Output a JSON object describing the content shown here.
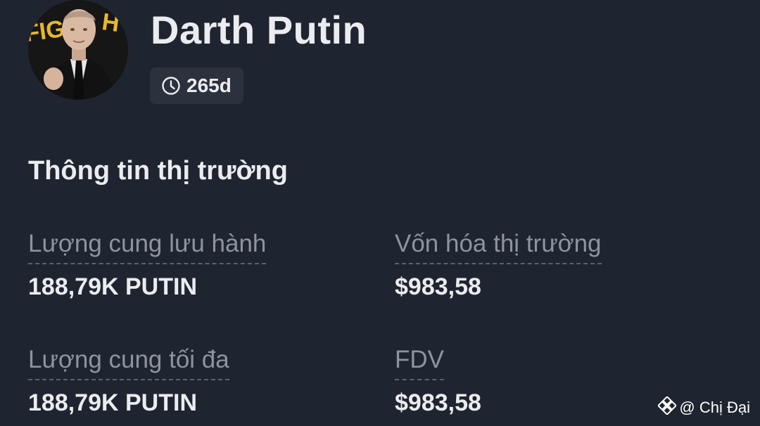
{
  "header": {
    "token_name": "Darth Putin",
    "age_badge": "265d",
    "avatar_icon": "person-photo-avatar"
  },
  "market_info": {
    "title": "Thông tin thị trường",
    "stats": [
      {
        "label": "Lượng cung lưu hành",
        "value": "188,79K PUTIN"
      },
      {
        "label": "Vốn hóa thị trường",
        "value": "$983,58"
      },
      {
        "label": "Lượng cung tối đa",
        "value": "188,79K PUTIN"
      },
      {
        "label": "FDV",
        "value": "$983,58"
      }
    ]
  },
  "watermark": {
    "icon": "binance-logo-icon",
    "text": "@ Chị Đại"
  },
  "colors": {
    "background": "#1f2530",
    "badge_bg": "#2b313d",
    "primary_text": "#eaecef",
    "secondary_text": "#8e949e"
  }
}
